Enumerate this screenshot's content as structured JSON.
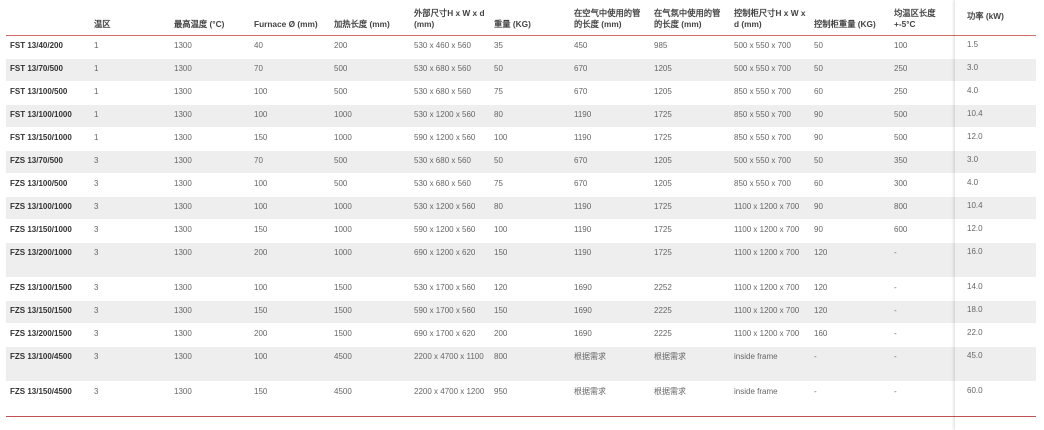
{
  "headers": [
    "",
    "温区",
    "最高温度 (°C)",
    "Furnace Ø (mm)",
    "加热长度 (mm)",
    "外部尺寸H x W x d (mm)",
    "重量 (KG)",
    "在空气中使用的管的长度 (mm)",
    "在气氛中使用的管的长度 (mm)",
    "控制柜尺寸H x W x d (mm)",
    "控制柜重量 (KG)",
    "均温区长度+-5°C"
  ],
  "power_header": "功率 (kW)",
  "rows": [
    {
      "cells": [
        "FST 13/40/200",
        "1",
        "1300",
        "40",
        "200",
        "530 x 460 x 560",
        "35",
        "450",
        "985",
        "500 x 550 x 700",
        "50",
        "100"
      ],
      "power": "1.5"
    },
    {
      "cells": [
        "FST 13/70/500",
        "1",
        "1300",
        "70",
        "500",
        "530 x 680 x 560",
        "50",
        "670",
        "1205",
        "500 x 550 x 700",
        "50",
        "250"
      ],
      "power": "3.0"
    },
    {
      "cells": [
        "FST 13/100/500",
        "1",
        "1300",
        "100",
        "500",
        "530 x 680 x 560",
        "75",
        "670",
        "1205",
        "850 x 550 x 700",
        "60",
        "250"
      ],
      "power": "4.0"
    },
    {
      "cells": [
        "FST 13/100/1000",
        "1",
        "1300",
        "100",
        "1000",
        "530 x 1200 x 560",
        "80",
        "1190",
        "1725",
        "850 x 550 x 700",
        "90",
        "500"
      ],
      "power": "10.4"
    },
    {
      "cells": [
        "FST 13/150/1000",
        "1",
        "1300",
        "150",
        "1000",
        "590 x 1200 x 560",
        "100",
        "1190",
        "1725",
        "850 x 550 x 700",
        "90",
        "500"
      ],
      "power": "12.0"
    },
    {
      "cells": [
        "FZS 13/70/500",
        "3",
        "1300",
        "70",
        "500",
        "530 x 680 x 560",
        "50",
        "670",
        "1205",
        "500 x 550 x 700",
        "50",
        "350"
      ],
      "power": "3.0"
    },
    {
      "cells": [
        "FZS 13/100/500",
        "3",
        "1300",
        "100",
        "500",
        "530 x 680 x 560",
        "75",
        "670",
        "1205",
        "850 x 550 x 700",
        "60",
        "300"
      ],
      "power": "4.0"
    },
    {
      "cells": [
        "FZS 13/100/1000",
        "3",
        "1300",
        "100",
        "1000",
        "530 x 1200 x 560",
        "80",
        "1190",
        "1725",
        "1100 x 1200 x 700",
        "90",
        "800"
      ],
      "power": "10.4"
    },
    {
      "cells": [
        "FZS 13/150/1000",
        "3",
        "1300",
        "150",
        "1000",
        "590 x 1200 x 560",
        "100",
        "1190",
        "1725",
        "1100 x 1200 x 700",
        "90",
        "600"
      ],
      "power": "12.0"
    },
    {
      "cells": [
        "FZS 13/200/1000",
        "3",
        "1300",
        "200",
        "1000",
        "690 x 1200 x 620",
        "150",
        "1190",
        "1725",
        "1100 x 1200 x 700",
        "120",
        "-"
      ],
      "power": "16.0"
    },
    {
      "cells": [
        "FZS 13/100/1500",
        "3",
        "1300",
        "100",
        "1500",
        "530 x 1700 x 560",
        "120",
        "1690",
        "2252",
        "1100 x 1200 x 700",
        "120",
        "-"
      ],
      "power": "14.0"
    },
    {
      "cells": [
        "FZS 13/150/1500",
        "3",
        "1300",
        "150",
        "1500",
        "590 x 1700 x 560",
        "150",
        "1690",
        "2225",
        "1100 x 1200 x 700",
        "120",
        "-"
      ],
      "power": "18.0"
    },
    {
      "cells": [
        "FZS 13/200/1500",
        "3",
        "1300",
        "200",
        "1500",
        "690 x 1700 x 620",
        "200",
        "1690",
        "2225",
        "1100 x 1200 x 700",
        "160",
        "-"
      ],
      "power": "22.0"
    },
    {
      "cells": [
        "FZS 13/100/4500",
        "3",
        "1300",
        "100",
        "4500",
        "2200 x 4700 x 1100",
        "800",
        "根据需求",
        "根据需求",
        "inside frame",
        "-",
        "-"
      ],
      "power": "45.0"
    },
    {
      "cells": [
        "FZS 13/150/4500",
        "3",
        "1300",
        "150",
        "4500",
        "2200 x 4700 x 1200",
        "950",
        "根据需求",
        "根据需求",
        "inside frame",
        "-",
        "-"
      ],
      "power": "60.0"
    }
  ]
}
